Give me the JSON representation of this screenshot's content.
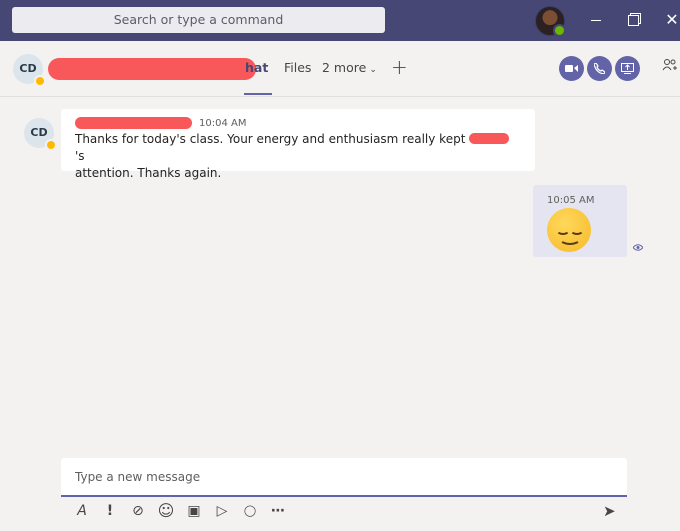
{
  "titlebar": {
    "search_placeholder": "Search or type a command"
  },
  "header": {
    "avatar_initials": "CD",
    "tabs": [
      {
        "label": "hat"
      },
      {
        "label": "Files"
      },
      {
        "label": "2 more"
      }
    ]
  },
  "messages": {
    "incoming": {
      "avatar_initials": "CD",
      "time": "10:04 AM",
      "line1_start": "Thanks for today's class.  Your energy and enthusiasm really kept ",
      "line1_end": "'s",
      "line2": "attention.  Thanks again."
    },
    "outgoing": {
      "time": "10:05 AM"
    }
  },
  "compose": {
    "placeholder": "Type a new message"
  },
  "icons": {
    "close": "✕",
    "plus": "+",
    "chevron": "⌄",
    "toolbar": [
      "A",
      "!",
      "⊘",
      "☺",
      "▣",
      "▷",
      "◯",
      "⋯"
    ],
    "send": "➤"
  },
  "colors": {
    "titlebar": "#464775",
    "accent": "#6264a7",
    "outgoing_bubble": "#e5e5f1",
    "away_status": "#ffb900",
    "available_status": "#6bb700"
  }
}
